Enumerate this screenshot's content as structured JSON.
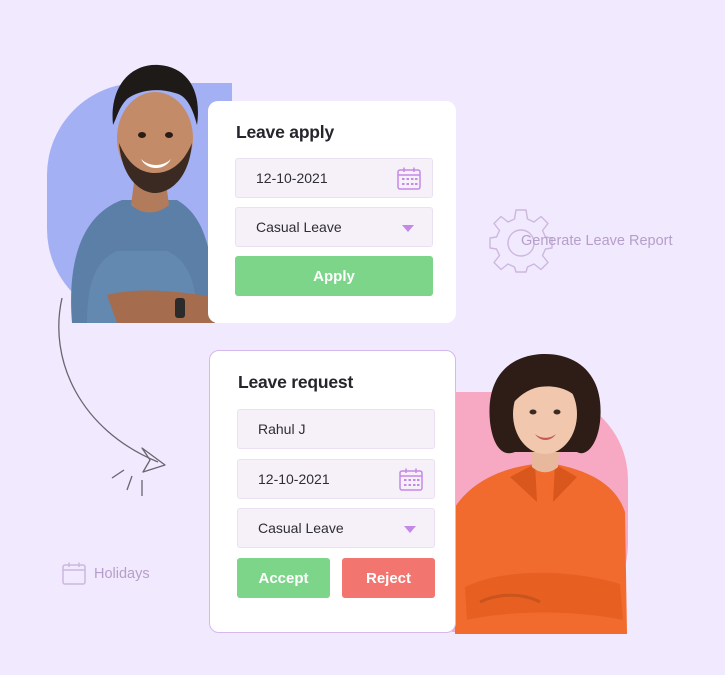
{
  "leave_apply": {
    "title": "Leave apply",
    "date_value": "12-10-2021",
    "leave_type": "Casual Leave",
    "apply_label": "Apply"
  },
  "leave_request": {
    "title": "Leave request",
    "employee_name": "Rahul J",
    "date_value": "12-10-2021",
    "leave_type": "Casual Leave",
    "accept_label": "Accept",
    "reject_label": "Reject"
  },
  "side_links": {
    "generate_report": "Generate Leave Report",
    "holidays": "Holidays"
  },
  "icons": {
    "calendar": "calendar-icon",
    "dropdown": "chevron-down-icon",
    "gear": "gear-icon",
    "arrow": "curved-arrow-icon"
  },
  "colors": {
    "background": "#f1e9fd",
    "accent_purple": "#c389e6",
    "apply_green": "#7dd58a",
    "reject_red": "#f2766f",
    "blob_blue": "#a3b0f4",
    "blob_pink": "#f7a9c4",
    "muted_label": "#b69ecb"
  }
}
